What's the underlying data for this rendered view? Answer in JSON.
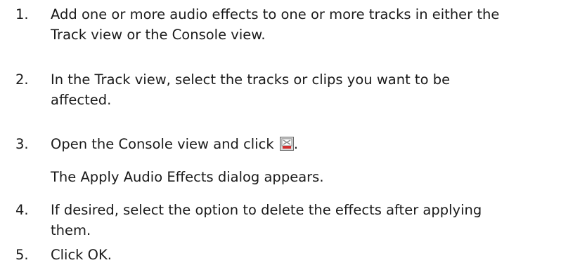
{
  "steps": [
    {
      "number": "1.",
      "lines": [
        "Add one or more audio effects to one or more tracks in either the",
        "Track view or the Console view."
      ]
    },
    {
      "number": "2.",
      "lines": [
        "In the Track view, select the tracks or clips you want to be",
        "affected."
      ]
    },
    {
      "number": "3.",
      "lines": [
        "Open the Console view and click "
      ],
      "icon": "apply-audio-effects-icon",
      "after_icon": "."
    },
    {
      "number": "4.",
      "lines": [
        "If desired, select the option to delete the effects after applying",
        "them."
      ]
    },
    {
      "number": "5.",
      "lines": [
        "Click OK."
      ]
    }
  ],
  "note": "The Apply Audio Effects dialog appears.",
  "colors": {
    "text": "#1a1a1a",
    "icon_red": "#d23030",
    "icon_gray": "#8a8a8a"
  }
}
